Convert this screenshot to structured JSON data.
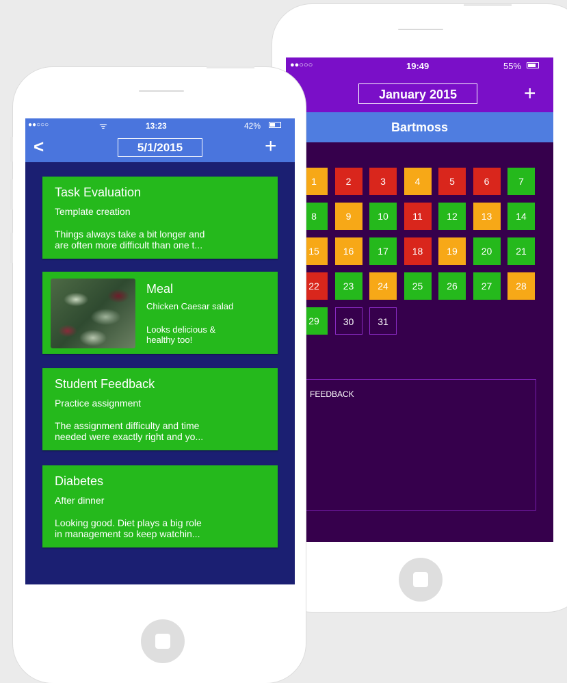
{
  "calendar_screen": {
    "status": {
      "signal": "●●○○○",
      "time": "19:49",
      "battery": "55%"
    },
    "nav": {
      "month": "January 2015",
      "add_label": "+",
      "back_label": "<"
    },
    "user_name": "Bartmoss",
    "colors": {
      "green": "#25b91c",
      "orange": "#f7a817",
      "red": "#d9261c",
      "empty": "transparent"
    },
    "days": [
      {
        "label": "1",
        "status": "orange"
      },
      {
        "label": "2",
        "status": "red"
      },
      {
        "label": "3",
        "status": "red"
      },
      {
        "label": "4",
        "status": "orange"
      },
      {
        "label": "5",
        "status": "red"
      },
      {
        "label": "6",
        "status": "red"
      },
      {
        "label": "7",
        "status": "green"
      },
      {
        "label": "8",
        "status": "green"
      },
      {
        "label": "9",
        "status": "orange"
      },
      {
        "label": "10",
        "status": "green"
      },
      {
        "label": "11",
        "status": "red"
      },
      {
        "label": "12",
        "status": "green"
      },
      {
        "label": "13",
        "status": "orange"
      },
      {
        "label": "14",
        "status": "green"
      },
      {
        "label": "15",
        "status": "orange"
      },
      {
        "label": "16",
        "status": "orange"
      },
      {
        "label": "17",
        "status": "green"
      },
      {
        "label": "18",
        "status": "red"
      },
      {
        "label": "19",
        "status": "orange"
      },
      {
        "label": "20",
        "status": "green"
      },
      {
        "label": "21",
        "status": "green"
      },
      {
        "label": "22",
        "status": "red"
      },
      {
        "label": "23",
        "status": "green"
      },
      {
        "label": "24",
        "status": "orange"
      },
      {
        "label": "25",
        "status": "green"
      },
      {
        "label": "26",
        "status": "green"
      },
      {
        "label": "27",
        "status": "green"
      },
      {
        "label": "28",
        "status": "orange"
      },
      {
        "label": "29",
        "status": "green"
      },
      {
        "label": "30",
        "status": "empty"
      },
      {
        "label": "31",
        "status": "empty"
      }
    ],
    "feedback_label": "FEEDBACK"
  },
  "entries_screen": {
    "status": {
      "signal": "●●○○○",
      "time": "13:23",
      "battery": "42%"
    },
    "nav": {
      "date": "5/1/2015",
      "add_label": "+",
      "back_label": "<"
    },
    "entries": [
      {
        "title": "Task Evaluation",
        "subtitle": "Template creation",
        "description": "Things always take a bit longer and\nare often more difficult than one t..."
      },
      {
        "title": "Meal",
        "subtitle": "Chicken Caesar salad",
        "description": "Looks delicious &\nhealthy too!"
      },
      {
        "title": "Student Feedback",
        "subtitle": "Practice assignment",
        "description": "The assignment difficulty and time\nneeded were exactly right and yo..."
      },
      {
        "title": "Diabetes",
        "subtitle": "After dinner",
        "description": "Looking good. Diet plays a big role\nin management so keep watchin..."
      }
    ]
  }
}
